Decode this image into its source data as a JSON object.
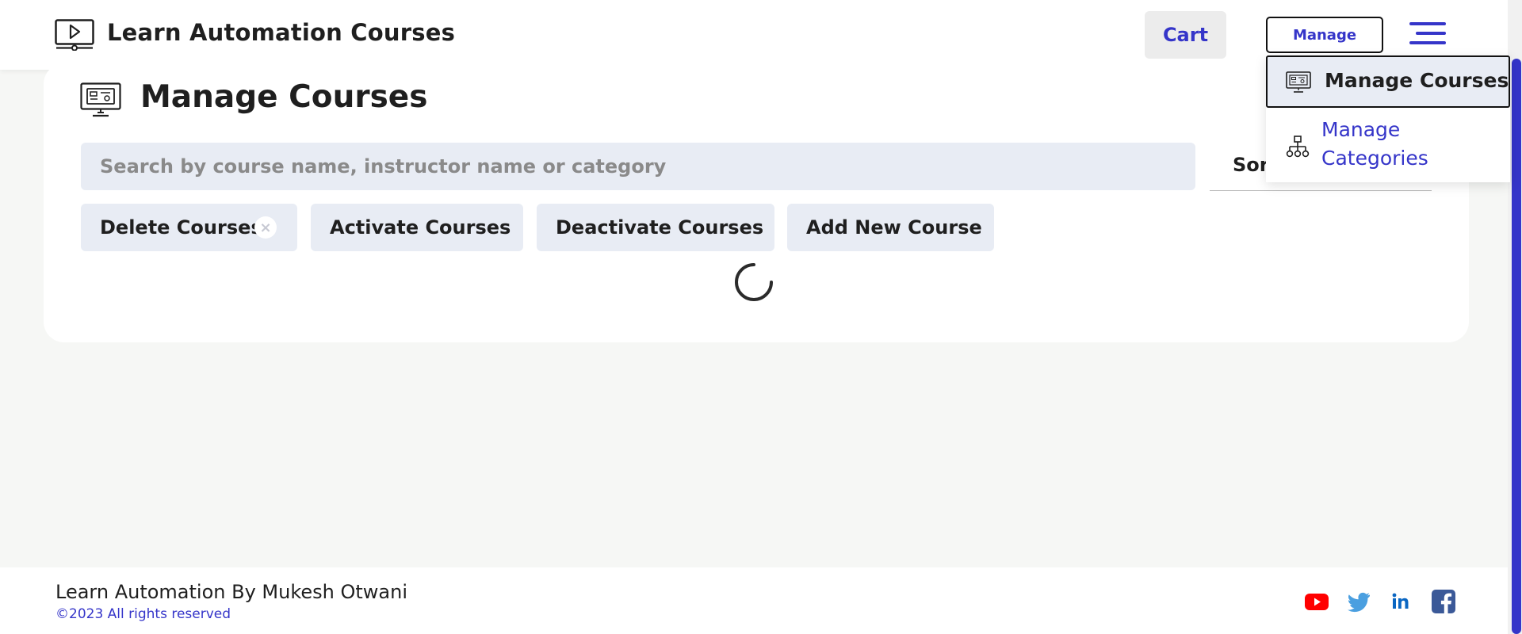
{
  "header": {
    "title": "Learn Automation Courses",
    "cart_label": "Cart",
    "manage_label": "Manage",
    "logo_icon": "video-monitor-icon",
    "menu_icon": "hamburger-menu-icon"
  },
  "page": {
    "title": "Manage Courses",
    "icon": "monitor-dashboard-icon",
    "search": {
      "placeholder": "Search by course name, instructor name or category",
      "value": ""
    },
    "sort_label": "Sor",
    "actions": {
      "delete": "Delete Courses",
      "delete_clear": "×",
      "activate": "Activate Courses",
      "deactivate": "Deactivate Courses",
      "add": "Add New Course"
    },
    "loading": true
  },
  "dropdown": {
    "items": [
      {
        "label": "Manage Courses",
        "icon": "monitor-dashboard-icon",
        "selected": true
      },
      {
        "label": "Manage Categories",
        "icon": "hierarchy-icon",
        "selected": false
      }
    ]
  },
  "footer": {
    "title": "Learn Automation By Mukesh Otwani",
    "copyright": "©2023 All rights reserved",
    "social": [
      "youtube-icon",
      "twitter-icon",
      "linkedin-icon",
      "facebook-icon"
    ]
  },
  "colors": {
    "accent": "#3535c9",
    "button_bg": "#e8ecf4",
    "page_bg": "#f6f7f5",
    "youtube": "#ff0000",
    "twitter": "#1da1f2",
    "linkedin": "#0a66c2",
    "facebook": "#3b5998"
  }
}
